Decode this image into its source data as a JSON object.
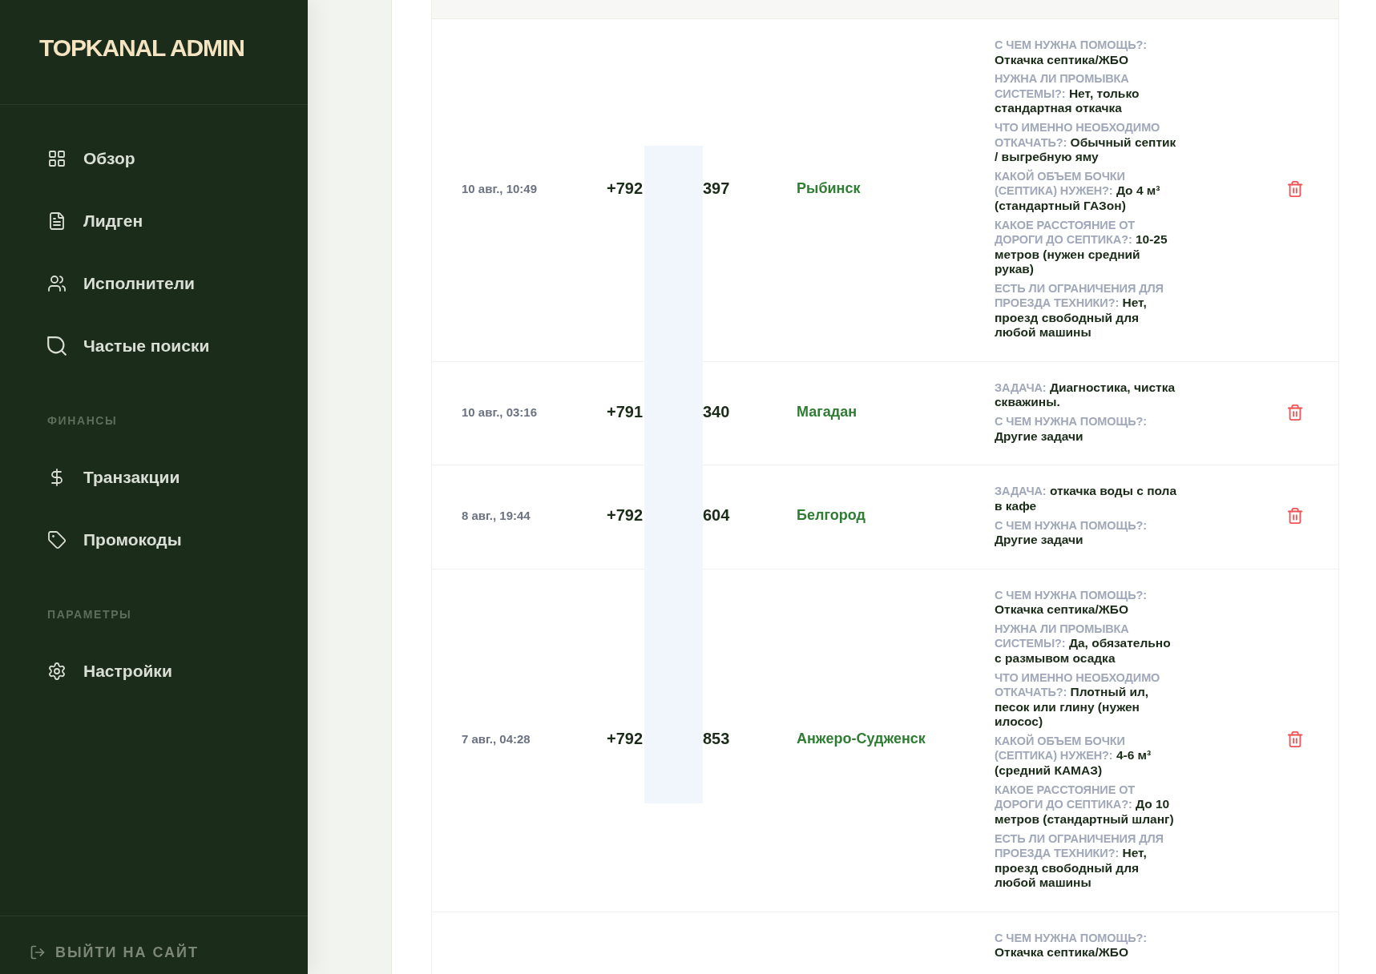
{
  "sidebar": {
    "logo": "TOPKANAL ADMIN",
    "sections": [
      {
        "items": [
          {
            "label": "Обзор"
          },
          {
            "label": "Лидген"
          },
          {
            "label": "Исполнители"
          },
          {
            "label": "Частые поиски"
          }
        ]
      },
      {
        "title": "ФИНАНСЫ",
        "items": [
          {
            "label": "Транзакции"
          },
          {
            "label": "Промокоды"
          }
        ]
      },
      {
        "title": "ПАРАМЕТРЫ",
        "items": [
          {
            "label": "Настройки"
          }
        ]
      }
    ],
    "footer_link": "ВЫЙТИ НА САЙТ"
  },
  "leads_table": {
    "rows": [
      {
        "date": "10 авг., 10:49",
        "phone": {
          "start": "+792",
          "end": "397"
        },
        "city": "Рыбинск",
        "details": [
          {
            "label": "С ЧЕМ НУЖНА ПОМОЩЬ?:",
            "value": "Откачка септика/ЖБО"
          },
          {
            "label": "НУЖНА ЛИ ПРОМЫВКА СИСТЕМЫ?:",
            "value": "Нет, только стандартная откачка"
          },
          {
            "label": "ЧТО ИМЕННО НЕОБХОДИМО ОТКАЧАТЬ?:",
            "value": "Обычный септик / выгребную яму"
          },
          {
            "label": "КАКОЙ ОБЪЕМ БОЧКИ (СЕПТИКА) НУЖЕН?:",
            "value": "До 4 м³ (стандартный ГАЗон)"
          },
          {
            "label": "КАКОЕ РАССТОЯНИЕ ОТ ДОРОГИ ДО СЕПТИКА?:",
            "value": "10-25 метров (нужен средний рукав)"
          },
          {
            "label": "ЕСТЬ ЛИ ОГРАНИЧЕНИЯ ДЛЯ ПРОЕЗДА ТЕХНИКИ?:",
            "value": "Нет, проезд свободный для любой машины"
          }
        ],
        "delete_button": true
      },
      {
        "date": "10 авг., 03:16",
        "phone": {
          "start": "+791",
          "end": "340"
        },
        "city": "Магадан",
        "details": [
          {
            "label": "ЗАДАЧА:",
            "value": "Диагностика, чистка скважины."
          },
          {
            "label": "С ЧЕМ НУЖНА ПОМОЩЬ?:",
            "value": "Другие задачи"
          }
        ],
        "delete_button": true
      },
      {
        "date": "8 авг., 19:44",
        "phone": {
          "start": "+792",
          "end": "604"
        },
        "city": "Белгород",
        "details": [
          {
            "label": "ЗАДАЧА:",
            "value": "откачка воды с пола в кафе"
          },
          {
            "label": "С ЧЕМ НУЖНА ПОМОЩЬ?:",
            "value": "Другие задачи"
          }
        ],
        "delete_button": true
      },
      {
        "date": "7 авг., 04:28",
        "phone": {
          "start": "+792",
          "end": "853"
        },
        "city": "Анжеро-Судженск",
        "details": [
          {
            "label": "С ЧЕМ НУЖНА ПОМОЩЬ?:",
            "value": "Откачка септика/ЖБО"
          },
          {
            "label": "НУЖНА ЛИ ПРОМЫВКА СИСТЕМЫ?:",
            "value": "Да, обязательно с размывом осадка"
          },
          {
            "label": "ЧТО ИМЕННО НЕОБХОДИМО ОТКАЧАТЬ?:",
            "value": "Плотный ил, песок или глину (нужен илосос)"
          },
          {
            "label": "КАКОЙ ОБЪЕМ БОЧКИ (СЕПТИКА) НУЖЕН?:",
            "value": "4-6 м³ (средний КАМАЗ)"
          },
          {
            "label": "КАКОЕ РАССТОЯНИЕ ОТ ДОРОГИ ДО СЕПТИКА?:",
            "value": "До 10 метров (стандартный шланг)"
          },
          {
            "label": "ЕСТЬ ЛИ ОГРАНИЧЕНИЯ ДЛЯ ПРОЕЗДА ТЕХНИКИ?:",
            "value": "Нет, проезд свободный для любой машины"
          }
        ],
        "delete_button": true
      },
      {
        "details": [
          {
            "label": "С ЧЕМ НУЖНА ПОМОЩЬ?:",
            "value": "Откачка септика/ЖБО"
          }
        ]
      }
    ]
  }
}
